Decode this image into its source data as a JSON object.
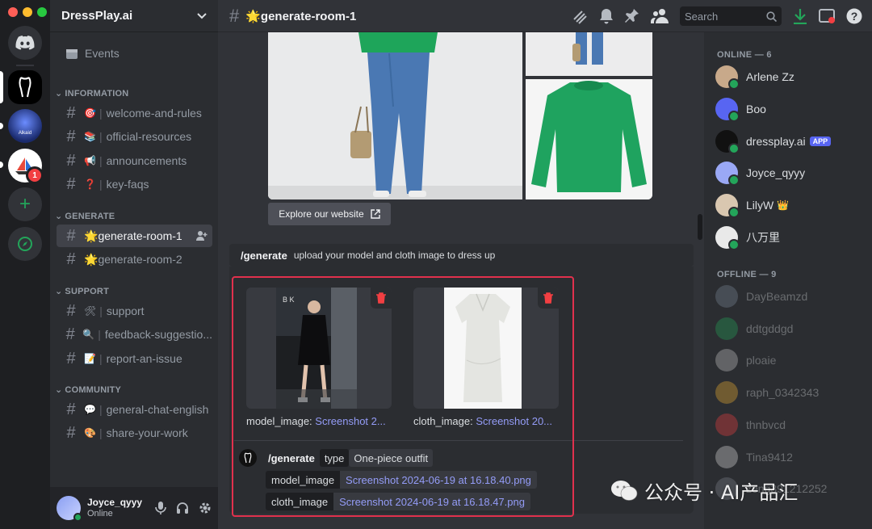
{
  "window": {
    "traffic": [
      "#ff5f57",
      "#febc2e",
      "#28c840"
    ]
  },
  "rail": {
    "servers": [
      {
        "name": "discord-home-icon"
      },
      {
        "name": "dressplay-server"
      },
      {
        "name": "alkaid-server",
        "label": "Alkaid"
      },
      {
        "name": "sailboat-server",
        "badge": "1"
      },
      {
        "name": "add-server-icon"
      },
      {
        "name": "explore-icon"
      }
    ]
  },
  "guild": {
    "name": "DressPlay.ai"
  },
  "sidebar": {
    "events": "Events",
    "categories": {
      "information": "INFORMATION",
      "generate": "GENERATE",
      "support": "SUPPORT",
      "community": "COMMUNITY"
    },
    "channels": {
      "welcome": {
        "emoji": "🎯",
        "label": "welcome-and-rules"
      },
      "official": {
        "emoji": "📚",
        "label": "official-resources"
      },
      "announcements": {
        "emoji": "📢",
        "label": "announcements"
      },
      "faqs": {
        "emoji": "❓",
        "label": "key-faqs"
      },
      "room1": {
        "emoji": "🌟",
        "label": "generate-room-1"
      },
      "room2": {
        "emoji": "🌟",
        "label": "generate-room-2"
      },
      "support": {
        "emoji": "🛠",
        "label": "support"
      },
      "feedback": {
        "emoji": "🔍",
        "label": "feedback-suggestio..."
      },
      "report": {
        "emoji": "📝",
        "label": "report-an-issue"
      },
      "general": {
        "emoji": "💬",
        "label": "general-chat-english"
      },
      "share": {
        "emoji": "🎨",
        "label": "share-your-work"
      }
    }
  },
  "user": {
    "name": "Joyce_qyyy",
    "status": "Online"
  },
  "topbar": {
    "channel_title": "🌟generate-room-1",
    "search_placeholder": "Search"
  },
  "chat": {
    "explore_button": "Explore our website",
    "command": {
      "name": "/generate",
      "description": "upload your model and cloth image to dress up"
    },
    "attachments": [
      {
        "key": "model_image:",
        "value": "Screenshot 2..."
      },
      {
        "key": "cloth_image:",
        "value": "Screenshot 20..."
      }
    ],
    "invocation": {
      "command": "/generate",
      "type_key": "type",
      "type_value": "One-piece outfit",
      "model_key": "model_image",
      "model_value": "Screenshot 2024-06-19 at 16.18.40.png",
      "cloth_key": "cloth_image",
      "cloth_value": "Screenshot 2024-06-19 at 16.18.47.png"
    }
  },
  "members": {
    "online_header": "ONLINE — 6",
    "offline_header": "OFFLINE — 9",
    "online": [
      {
        "name": "Arlene Zz",
        "color": "#c8a98a"
      },
      {
        "name": "Boo",
        "color": "#5865f2"
      },
      {
        "name": "dressplay.ai",
        "color": "#111111",
        "tag": "APP"
      },
      {
        "name": "Joyce_qyyy",
        "color": "#9aa8f5"
      },
      {
        "name": "LilyW",
        "color": "#d9c7b0",
        "crown": "👑"
      },
      {
        "name": "八万里",
        "color": "#e9e9e9"
      }
    ],
    "offline": [
      {
        "name": "DayBeamzd",
        "color": "#7c8a9a"
      },
      {
        "name": "ddtgddgd",
        "color": "#23a55a"
      },
      {
        "name": "ploaie",
        "color": "#c9c9c9"
      },
      {
        "name": "raph_0342343",
        "color": "#f0b232"
      },
      {
        "name": "thnbvcd",
        "color": "#f23f42"
      },
      {
        "name": "Tina9412",
        "color": "#e0e0e0"
      },
      {
        "name": "zeng391212252",
        "color": "#80848e"
      }
    ]
  },
  "watermark": {
    "text": "公众号 · AI产品汇"
  }
}
